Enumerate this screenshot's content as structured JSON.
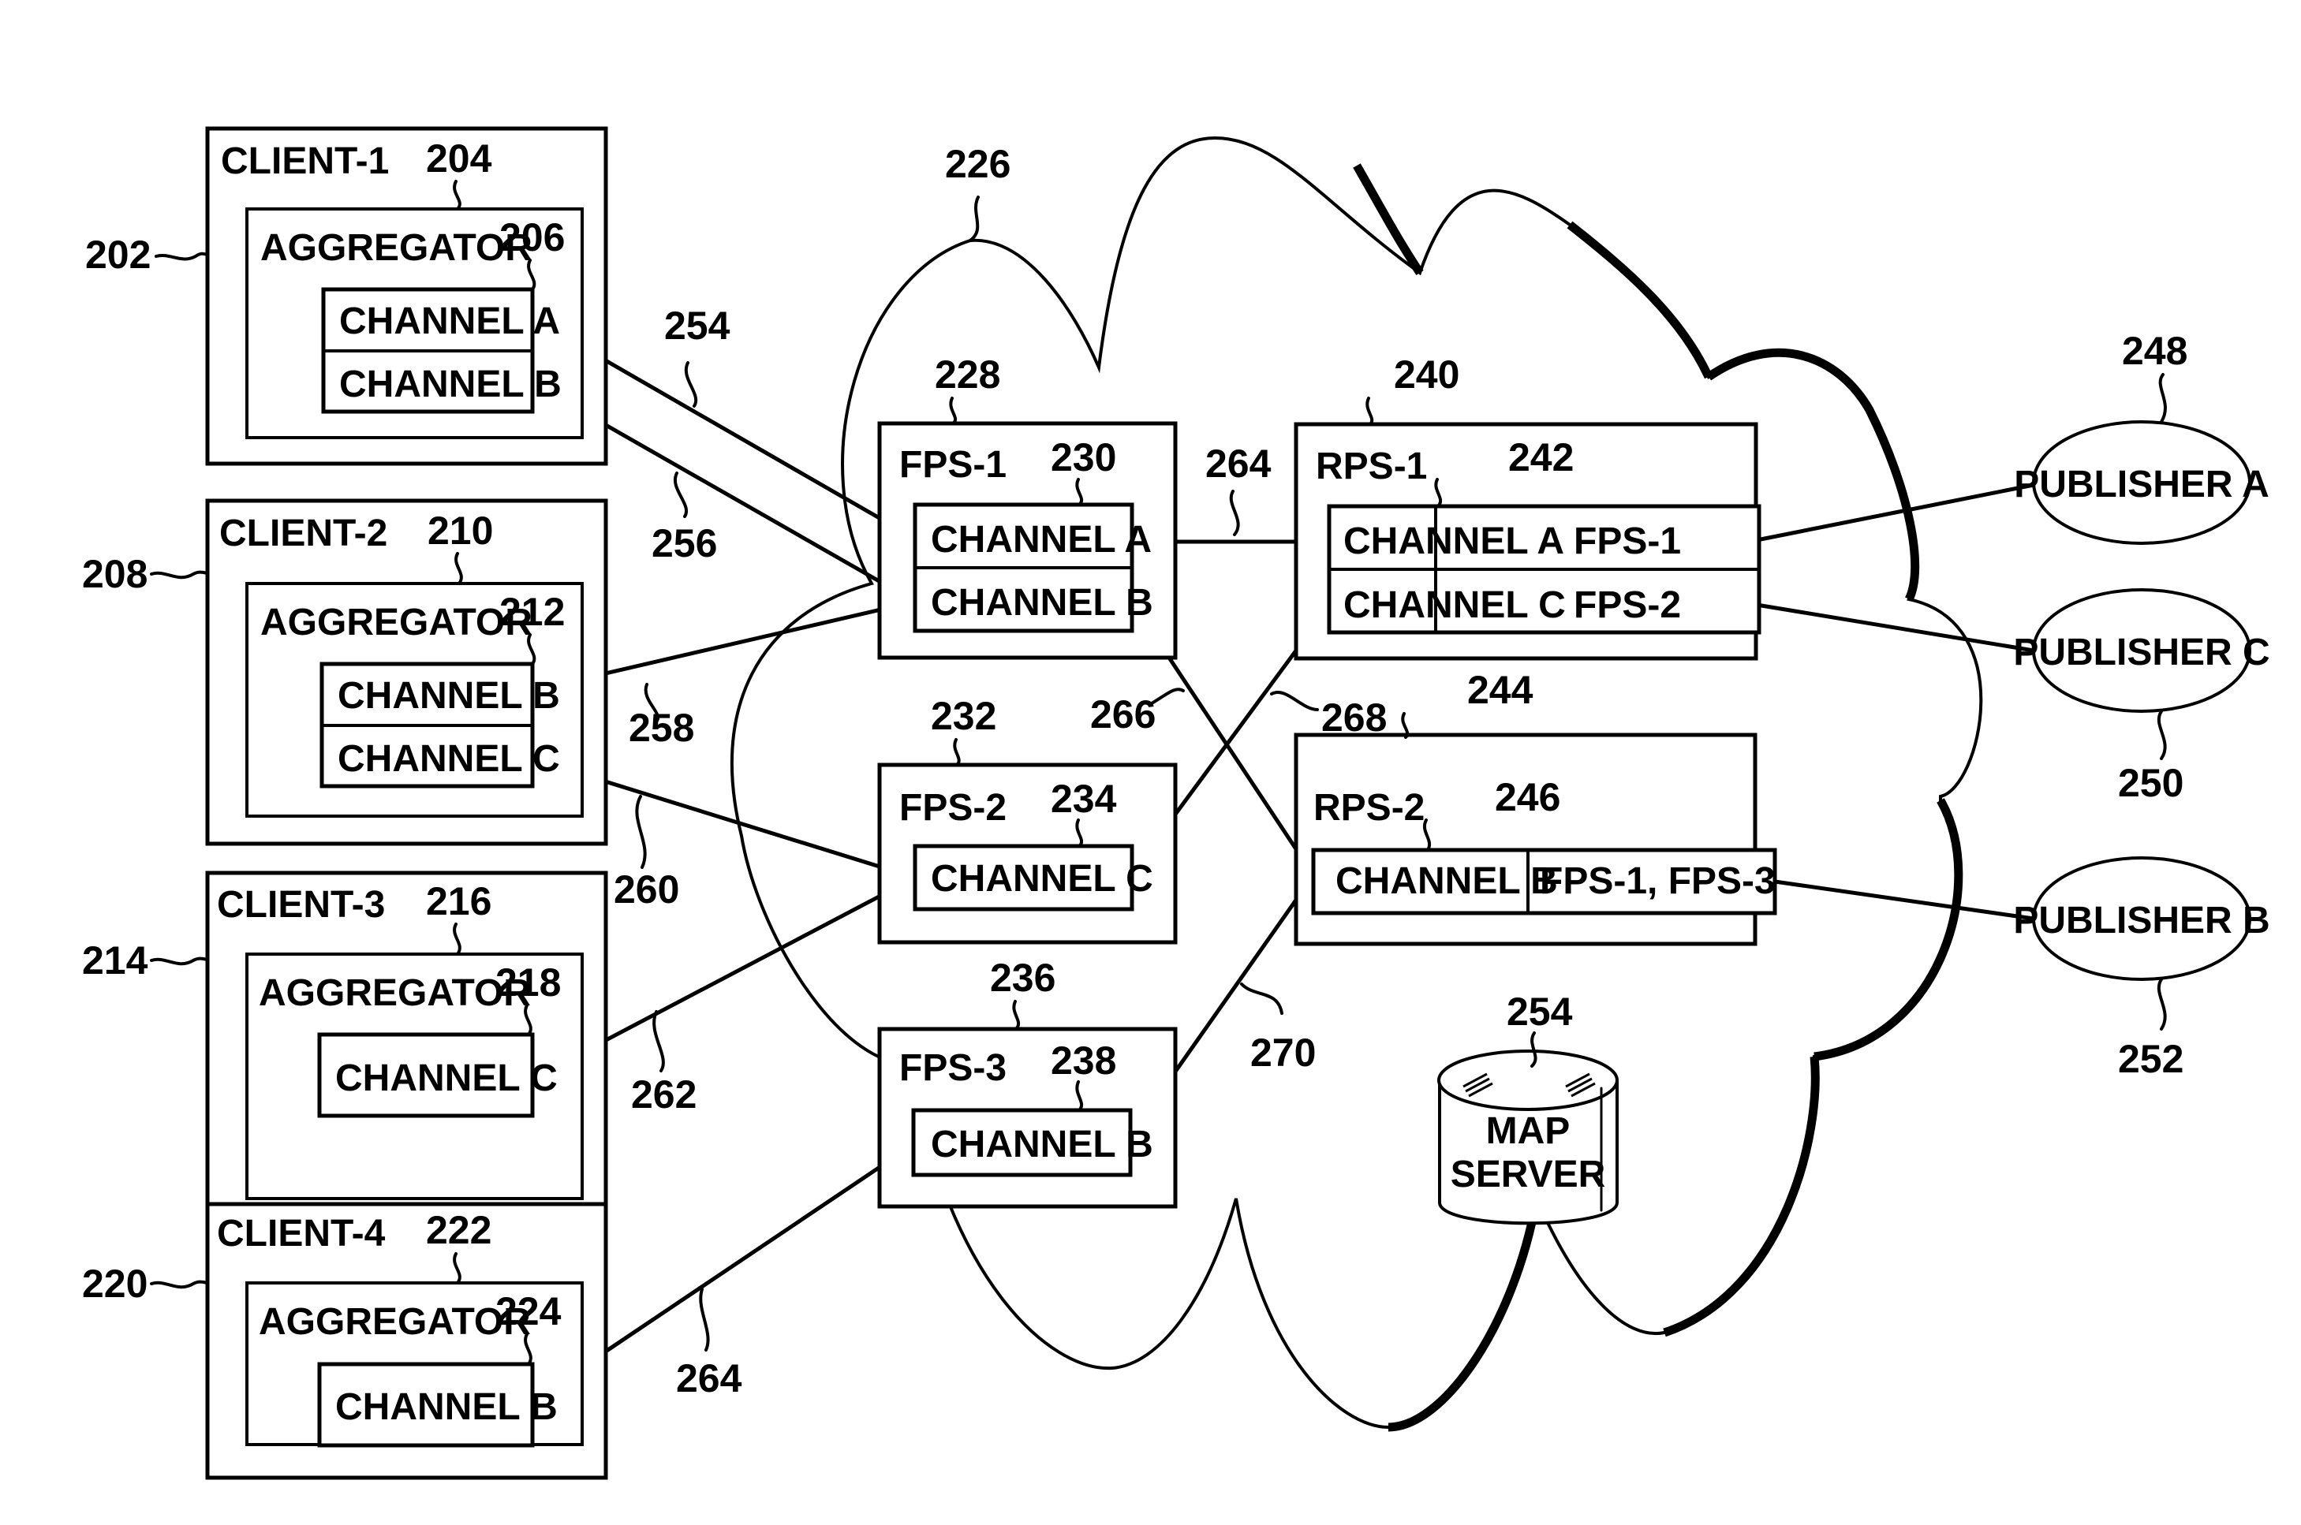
{
  "figure": {
    "cloud_ref": "226",
    "clients": [
      {
        "name": "CLIENT-1",
        "ref": "202",
        "aggregator_ref": "204",
        "aggregator_label": "AGGREGATOR",
        "channels_ref": "206",
        "channels": [
          "CHANNEL A",
          "CHANNEL B"
        ]
      },
      {
        "name": "CLIENT-2",
        "ref": "208",
        "aggregator_ref": "210",
        "aggregator_label": "AGGREGATOR",
        "channels_ref": "212",
        "channels": [
          "CHANNEL B",
          "CHANNEL C"
        ]
      },
      {
        "name": "CLIENT-3",
        "ref": "214",
        "aggregator_ref": "216",
        "aggregator_label": "AGGREGATOR",
        "channels_ref": "218",
        "channels": [
          "CHANNEL C"
        ]
      },
      {
        "name": "CLIENT-4",
        "ref": "220",
        "aggregator_ref": "222",
        "aggregator_label": "AGGREGATOR",
        "channels_ref": "224",
        "channels": [
          "CHANNEL B"
        ]
      }
    ],
    "fps": [
      {
        "name": "FPS-1",
        "ref": "228",
        "channels_ref": "230",
        "channels": [
          "CHANNEL A",
          "CHANNEL B"
        ]
      },
      {
        "name": "FPS-2",
        "ref": "232",
        "channels_ref": "234",
        "channels": [
          "CHANNEL C"
        ]
      },
      {
        "name": "FPS-3",
        "ref": "236",
        "channels_ref": "238",
        "channels": [
          "CHANNEL B"
        ]
      }
    ],
    "rps": [
      {
        "name": "RPS-1",
        "ref": "240",
        "table_ref": "242",
        "rows": [
          [
            "CHANNEL A",
            "FPS-1"
          ],
          [
            "CHANNEL C",
            "FPS-2"
          ]
        ]
      },
      {
        "name": "RPS-2",
        "ref": "244",
        "table_ref": "246",
        "rows": [
          [
            "CHANNEL B",
            "FPS-1, FPS-3"
          ]
        ]
      }
    ],
    "publishers": [
      {
        "name": "PUBLISHER A",
        "ref": "248"
      },
      {
        "name": "PUBLISHER C",
        "ref": "250"
      },
      {
        "name": "PUBLISHER B",
        "ref": "252"
      }
    ],
    "map_server": {
      "line1": "MAP",
      "line2": "SERVER",
      "ref": "254"
    },
    "link_refs": {
      "c1a_fps1a": "254",
      "c1b_fps1b": "256",
      "c2b_fps1b": "258",
      "c2c_fps2c": "260",
      "c3c_fps2c": "262",
      "c4b_fps3b": "264",
      "fps1a_rps1a": "264",
      "fps1b_rps2b": "266",
      "fps2c_rps1c": "268",
      "fps3b_rps2b": "270"
    }
  }
}
